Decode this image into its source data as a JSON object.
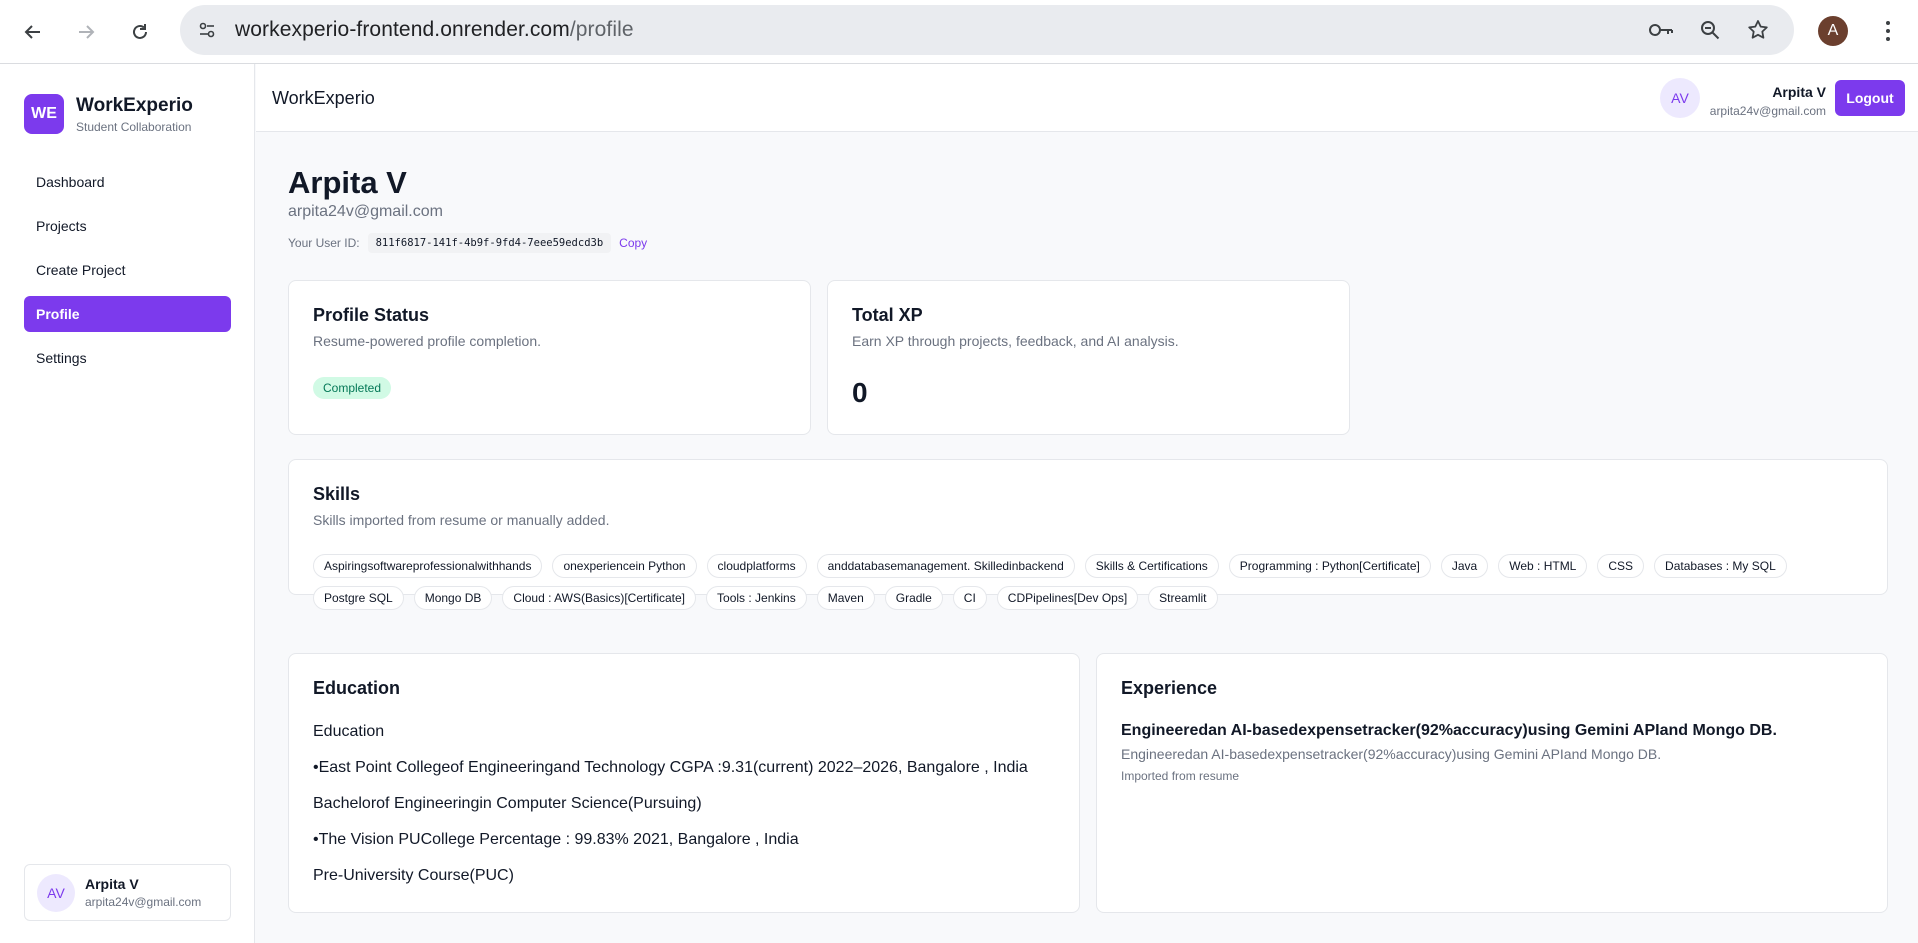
{
  "browser": {
    "url_host": "workexperio-frontend.onrender.com",
    "url_path": "/profile",
    "profile_initial": "A"
  },
  "brand": {
    "logo": "WE",
    "title": "WorkExperio",
    "subtitle": "Student Collaboration"
  },
  "sidebar": {
    "items": [
      {
        "label": "Dashboard"
      },
      {
        "label": "Projects"
      },
      {
        "label": "Create Project"
      },
      {
        "label": "Profile"
      },
      {
        "label": "Settings"
      }
    ],
    "active_index": 3,
    "user": {
      "initials": "AV",
      "name": "Arpita V",
      "email": "arpita24v@gmail.com"
    }
  },
  "topbar": {
    "title": "WorkExperio",
    "user_initials": "AV",
    "user_name": "Arpita V",
    "user_email": "arpita24v@gmail.com",
    "logout_label": "Logout"
  },
  "profile": {
    "name": "Arpita V",
    "email": "arpita24v@gmail.com",
    "user_id_label": "Your User ID:",
    "user_id": "811f6817-141f-4b9f-9fd4-7eee59edcd3b",
    "copy_label": "Copy"
  },
  "status_card": {
    "title": "Profile Status",
    "subtitle": "Resume-powered profile completion.",
    "badge": "Completed"
  },
  "xp_card": {
    "title": "Total XP",
    "subtitle": "Earn XP through projects, feedback, and AI analysis.",
    "value": "0"
  },
  "skills_card": {
    "title": "Skills",
    "subtitle": "Skills imported from resume or manually added.",
    "skills": [
      "Aspiringsoftwareprofessionalwithhands",
      "onexperiencein Python",
      "cloudplatforms",
      "anddatabasemanagement. Skilledinbackend",
      "Skills & Certifications",
      "Programming : Python[Certificate]",
      "Java",
      "Web : HTML",
      "CSS",
      "Databases : My SQL",
      "Postgre SQL",
      "Mongo DB",
      "Cloud : AWS(Basics)[Certificate]",
      "Tools : Jenkins",
      "Maven",
      "Gradle",
      "CI",
      "CDPipelines[Dev Ops]",
      "Streamlit"
    ]
  },
  "education_card": {
    "title": "Education",
    "lines": [
      "Education",
      "•East Point Collegeof Engineeringand Technology CGPA :9.31(current) 2022–2026, Bangalore , India",
      "Bachelorof Engineeringin Computer Science(Pursuing)",
      "•The Vision PUCollege Percentage : 99.83% 2021, Bangalore , India",
      "Pre-University Course(PUC)"
    ]
  },
  "experience_card": {
    "title": "Experience",
    "item_title": "Engineeredan AI-basedexpensetracker(92%accuracy)using Gemini APIand Mongo DB.",
    "item_desc": "Engineeredan AI-basedexpensetracker(92%accuracy)using Gemini APIand Mongo DB.",
    "item_source": "Imported from resume"
  },
  "colors": {
    "accent": "#7c3aed",
    "badge_bg": "#d1fae5",
    "badge_text": "#047857"
  }
}
